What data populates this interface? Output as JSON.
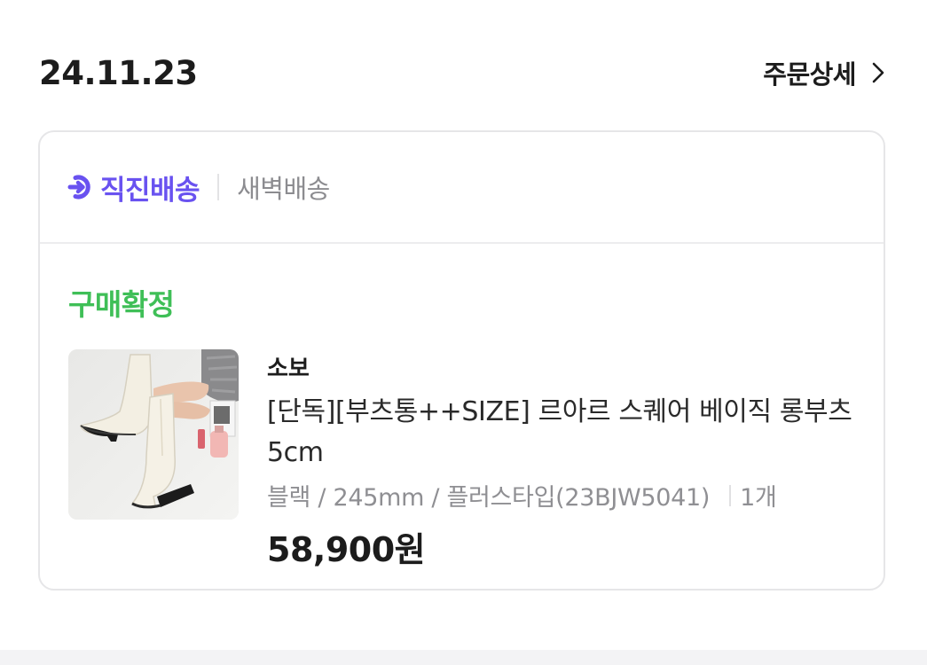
{
  "order": {
    "date": "24.11.23",
    "detail_label": "주문상세"
  },
  "delivery": {
    "direct_label": "직진배송",
    "dawn_label": "새벽배송"
  },
  "status": "구매확정",
  "product": {
    "brand": "소보",
    "name": "[단독][부츠통++SIZE] 르아르 스퀘어 베이직 롱부츠 5cm",
    "option": "블랙 / 245mm / 플러스타입(23BJW5041)",
    "quantity": "1개",
    "price": "58,900원"
  },
  "colors": {
    "accent_purple": "#6952f0",
    "status_green": "#3fbf57",
    "text_gray": "#8f8f93"
  },
  "icons": {
    "detail": "chevron-right-icon",
    "delivery": "arrow-circle-right-icon"
  }
}
